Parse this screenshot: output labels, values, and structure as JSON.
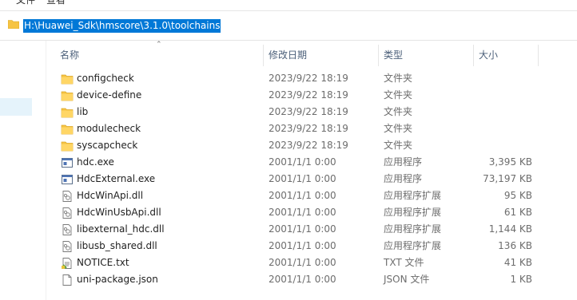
{
  "menubar": {
    "items": [
      "文件",
      "查看"
    ]
  },
  "address": {
    "path": "H:\\Huawei_Sdk\\hmscore\\3.1.0\\toolchains"
  },
  "columns": {
    "name": "名称",
    "date": "修改日期",
    "type": "类型",
    "size": "大小"
  },
  "files": [
    {
      "name": "configcheck",
      "date": "2023/9/22 18:19",
      "type": "文件夹",
      "size": "",
      "icon": "folder-icon"
    },
    {
      "name": "device-define",
      "date": "2023/9/22 18:19",
      "type": "文件夹",
      "size": "",
      "icon": "folder-icon"
    },
    {
      "name": "lib",
      "date": "2023/9/22 18:19",
      "type": "文件夹",
      "size": "",
      "icon": "folder-icon"
    },
    {
      "name": "modulecheck",
      "date": "2023/9/22 18:19",
      "type": "文件夹",
      "size": "",
      "icon": "folder-icon"
    },
    {
      "name": "syscapcheck",
      "date": "2023/9/22 18:19",
      "type": "文件夹",
      "size": "",
      "icon": "folder-icon"
    },
    {
      "name": "hdc.exe",
      "date": "2001/1/1 0:00",
      "type": "应用程序",
      "size": "3,395 KB",
      "icon": "exe-icon"
    },
    {
      "name": "HdcExternal.exe",
      "date": "2001/1/1 0:00",
      "type": "应用程序",
      "size": "73,197 KB",
      "icon": "exe-icon"
    },
    {
      "name": "HdcWinApi.dll",
      "date": "2001/1/1 0:00",
      "type": "应用程序扩展",
      "size": "95 KB",
      "icon": "dll-icon"
    },
    {
      "name": "HdcWinUsbApi.dll",
      "date": "2001/1/1 0:00",
      "type": "应用程序扩展",
      "size": "61 KB",
      "icon": "dll-icon"
    },
    {
      "name": "libexternal_hdc.dll",
      "date": "2001/1/1 0:00",
      "type": "应用程序扩展",
      "size": "1,144 KB",
      "icon": "dll-icon"
    },
    {
      "name": "libusb_shared.dll",
      "date": "2001/1/1 0:00",
      "type": "应用程序扩展",
      "size": "136 KB",
      "icon": "dll-icon"
    },
    {
      "name": "NOTICE.txt",
      "date": "2001/1/1 0:00",
      "type": "TXT 文件",
      "size": "41 KB",
      "icon": "txt-icon"
    },
    {
      "name": "uni-package.json",
      "date": "2001/1/1 0:00",
      "type": "JSON 文件",
      "size": "1 KB",
      "icon": "file-icon"
    }
  ],
  "colors": {
    "selection": "#0078d7",
    "header_text": "#4c607a",
    "folder": "#f6c443"
  }
}
